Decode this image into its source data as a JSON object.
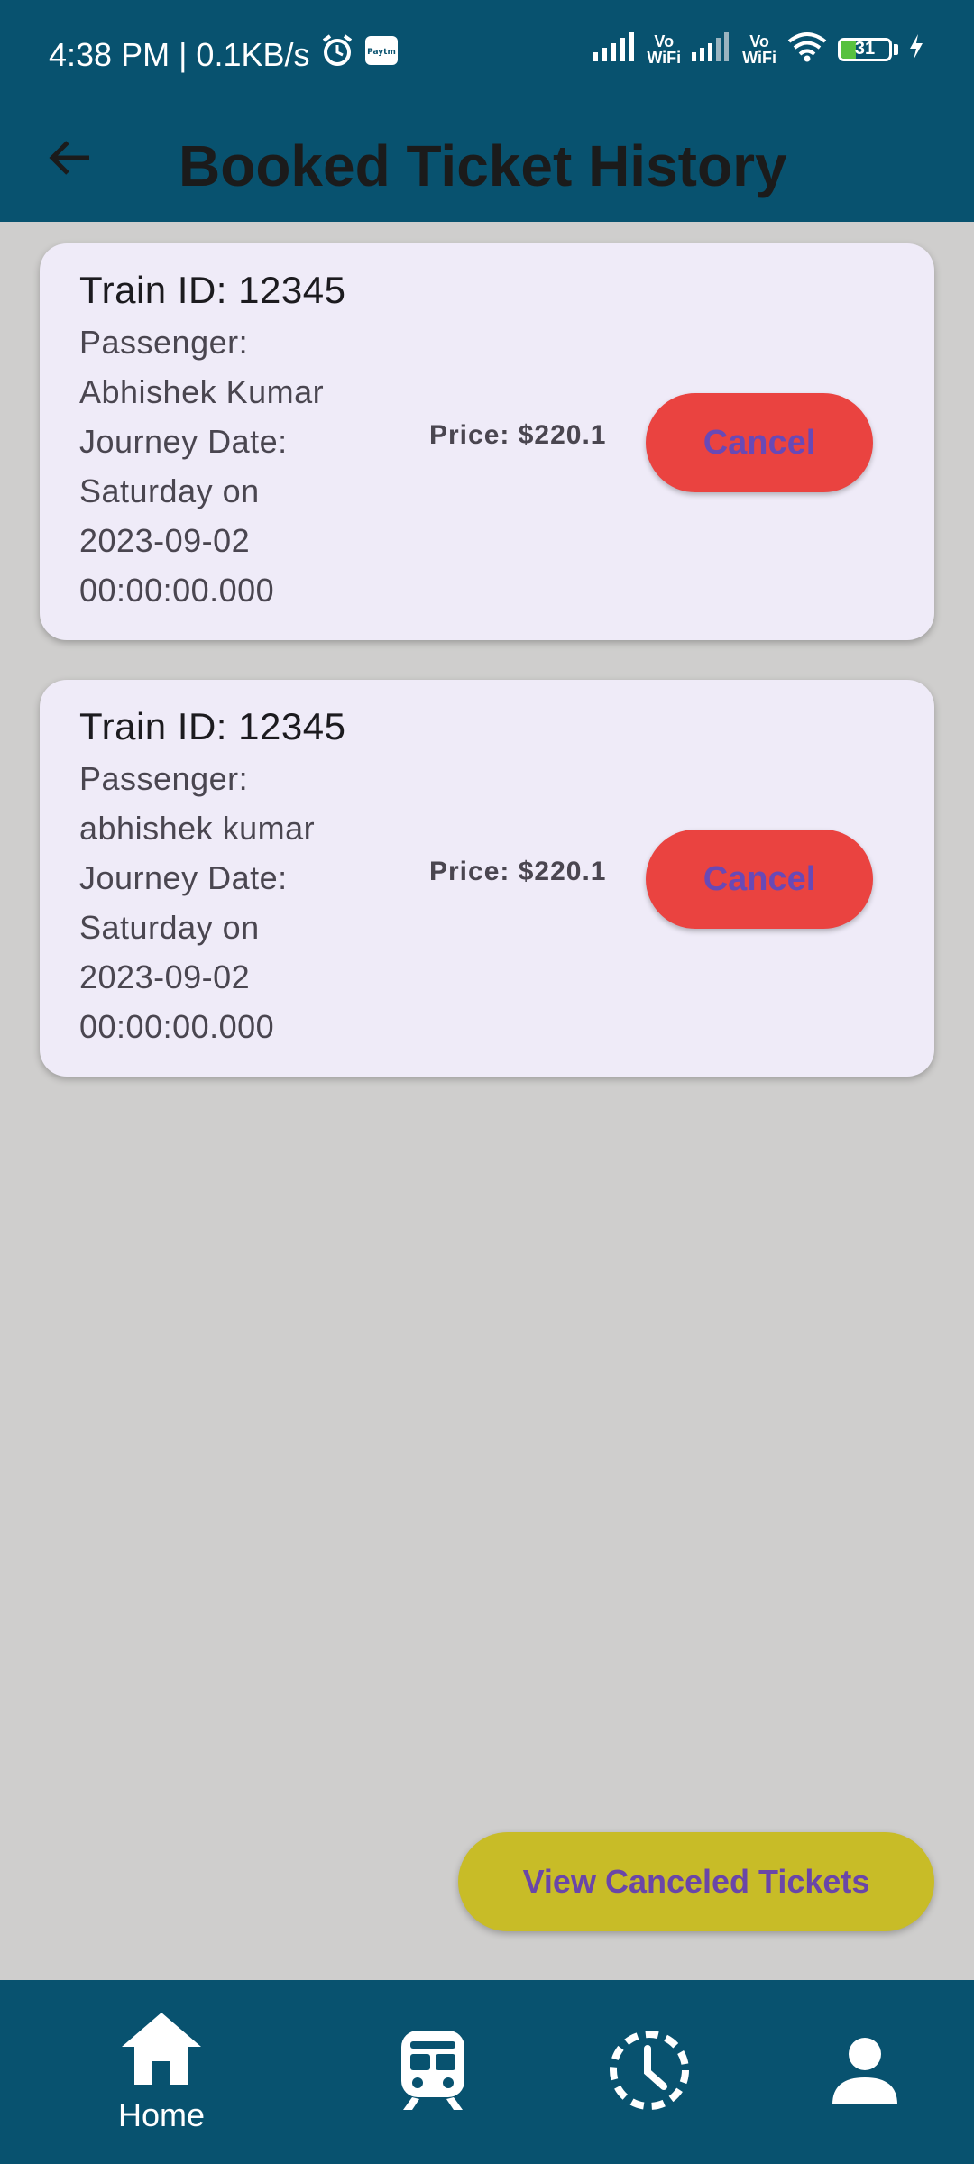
{
  "status_bar": {
    "time_speed": "4:38 PM | 0.1KB/s",
    "alarm_icon": "alarm-clock-icon",
    "paytm_icon": "paytm-notification-icon",
    "paytm_label": "Paytm",
    "vowifi_1": "Vo\nWiFi",
    "vowifi_2": "Vo\nWiFi",
    "battery_level": "31",
    "battery_fraction": 0.31,
    "charging_icon": "lightning-bolt-icon",
    "wifi_icon": "wifi-icon",
    "signal_icon": "cell-signal-icon"
  },
  "app_bar": {
    "back_icon": "arrow-back-icon",
    "title": "Booked Ticket History"
  },
  "tickets": [
    {
      "train_id": "Train ID: 12345",
      "details": "Passenger:\nAbhishek Kumar\nJourney Date:\nSaturday on\n2023-09-02\n00:00:00.000",
      "price": "Price: $220.1",
      "cancel_label": "Cancel"
    },
    {
      "train_id": "Train ID: 12345",
      "details": "Passenger:\nabhishek kumar\nJourney Date:\nSaturday on\n2023-09-02\n00:00:00.000",
      "price": "Price: $220.1",
      "cancel_label": "Cancel"
    }
  ],
  "fab": {
    "label": "View Canceled Tickets"
  },
  "bottom_nav": {
    "items": [
      {
        "icon": "home-icon",
        "label": "Home",
        "selected": true
      },
      {
        "icon": "train-icon",
        "label": ""
      },
      {
        "icon": "history-clock-icon",
        "label": ""
      },
      {
        "icon": "person-icon",
        "label": ""
      }
    ]
  },
  "colors": {
    "primary": "#08526f",
    "background": "#cfcecd",
    "card": "#efebf8",
    "cancel": "#ea4340",
    "cancel_text": "#6949b6",
    "fab": "#c8bc27",
    "fab_text": "#6a46a8"
  }
}
